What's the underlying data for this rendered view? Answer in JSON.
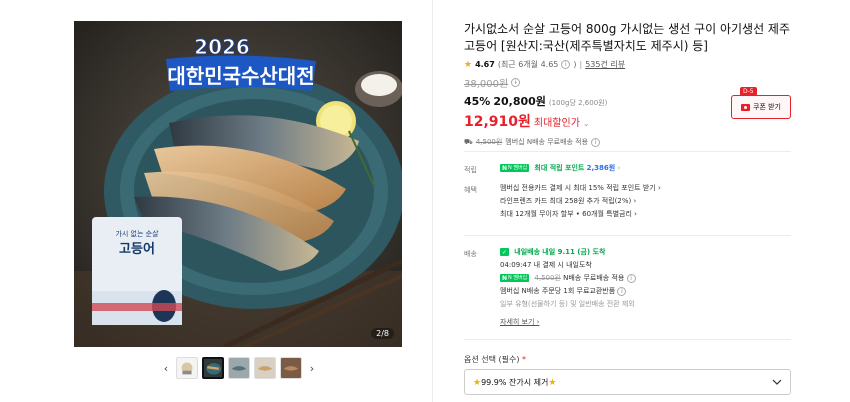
{
  "gallery": {
    "banner_year": "2026",
    "banner_title": "대한민국수산대전",
    "package_text_top": "가시 없는 순살",
    "package_text_main": "고등어",
    "counter": "2/8",
    "prev_label": "‹",
    "next_label": "›"
  },
  "product": {
    "title": "가시없소서 순살 고등어 800g 가시없는 생선 구이 아기생선 제주고등어 [원산지:국산(제주특별자치도 제주시) 등]",
    "rating_star": "★",
    "rating_score": "4.67",
    "rating_recent": "(최근 6개월 4.65",
    "rating_recent_close": ")",
    "rating_sep": "|",
    "review_count": "535건 리뷰",
    "original_price": "38,000원",
    "discount_rate": "45%",
    "sale_price": "20,800원",
    "unit_price": "(100g당 2,600원)",
    "best_price": "12,910원",
    "best_label": "최대할인가",
    "best_chevron": "⌄",
    "shipping_note_strike": "4,500원",
    "shipping_note": "멤버십 N배송 무료배송 적용"
  },
  "coupon": {
    "tag": "D-5",
    "label": "쿠폰 받기"
  },
  "points": {
    "label": "적립",
    "badge": "N 멤버십",
    "text_prefix": "최대 적립 포인트",
    "amount": "2,386원",
    "chevron": "›"
  },
  "benefits": {
    "label": "혜택",
    "items": [
      "멤버십 전용카드 결제 시 최대 15% 적립 포인트 받기 ›",
      "라인프렌즈 카드 최대 258원 추가 적립(2%) ›",
      "최대 12개월 무이자 할부 • 60개월 특별금리 ›"
    ]
  },
  "delivery": {
    "label": "배송",
    "arrival_badge": "내일배송",
    "arrival_text": "내일 9.11 (금) 도착",
    "order_note": "04:09:47  내 결제 시 내일도착",
    "membership_badge": "N 멤버십",
    "fee_strike": "4,500원",
    "fee_text": "N배송 무료배송 적용",
    "exchange_text": "멤버십 N배송 주문당 1회 무료교환반품",
    "exception_text": "일부 유형(선물하기 등) 및 일반배송 전환 제외",
    "details_link": "자세히 보기 ›"
  },
  "options": {
    "label": "옵션 선택 (필수)",
    "required_mark": "*",
    "selected_value": "99.9% 잔가시 제거",
    "star": "★"
  }
}
